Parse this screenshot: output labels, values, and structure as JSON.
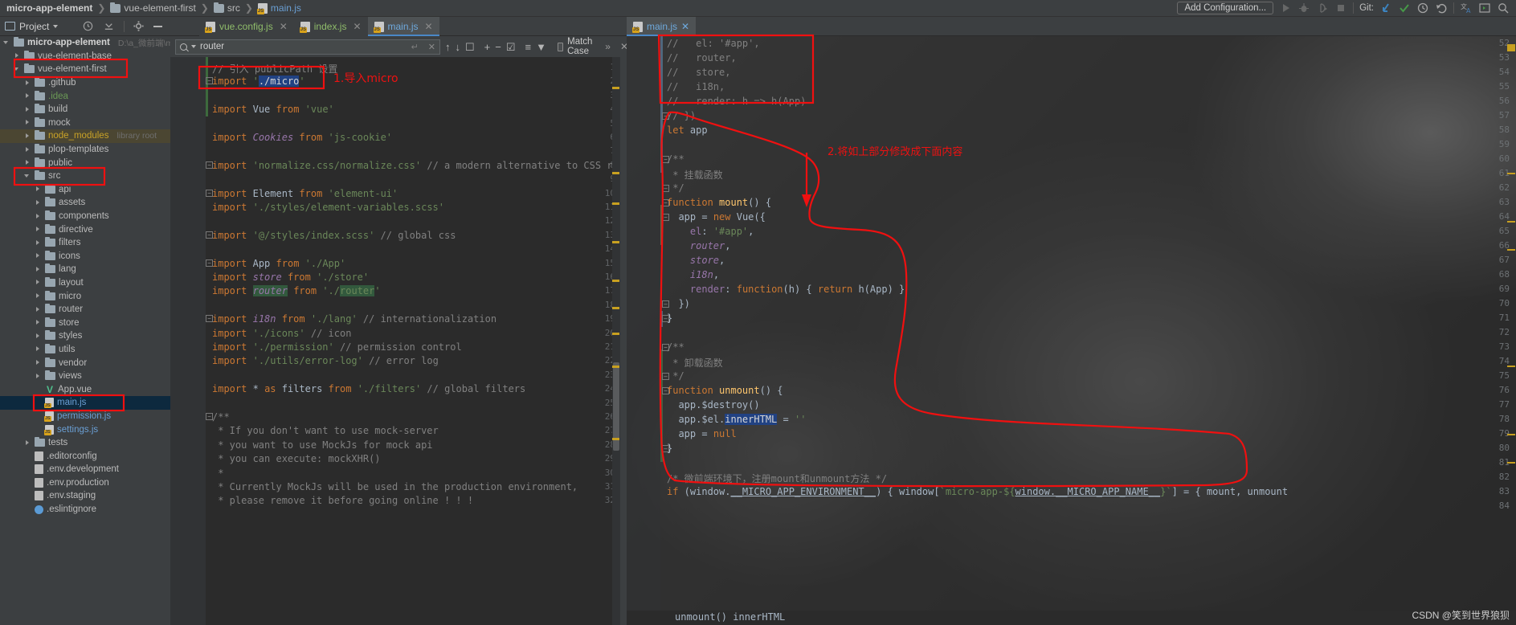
{
  "navbar": {
    "breadcrumbs": [
      {
        "label": "micro-app-element",
        "icon": "none",
        "bold": true
      },
      {
        "label": "vue-element-first",
        "icon": "folder-icon",
        "bold": false
      },
      {
        "label": "src",
        "icon": "folder-icon",
        "bold": false
      },
      {
        "label": "main.js",
        "icon": "js-file-icon",
        "bold": false
      }
    ],
    "add_configuration": "Add Configuration...",
    "git_label": "Git:",
    "icons": [
      "run-icon",
      "debug-icon",
      "coverage-icon",
      "stop-icon",
      "update-project-icon",
      "commit-icon",
      "history-icon",
      "rollback-icon",
      "translate-icon",
      "terminal-icon",
      "search-everywhere-icon"
    ]
  },
  "toolbar": {
    "project_label": "Project",
    "icons": [
      "clock-icon",
      "collapse-icon",
      "gear-icon",
      "minimize-icon"
    ]
  },
  "tabs": [
    {
      "label": "vue.config.js",
      "active": false
    },
    {
      "label": "index.js",
      "active": false
    },
    {
      "label": "main.js",
      "active": true
    }
  ],
  "right_tab": {
    "label": "main.js"
  },
  "find": {
    "query": "router",
    "match_case_label": "Match Case",
    "more_label": "»",
    "icons": [
      "search-icon",
      "prev-match-icon",
      "next-match-icon",
      "select-all-icon",
      "add-occurrence-icon",
      "remove-occurrence-icon",
      "select-all-occurrences-icon",
      "filter-list-icon",
      "filter-icon"
    ]
  },
  "tree": [
    {
      "indent": 0,
      "arrow": "down",
      "icon": "folder-icon",
      "label": "micro-app-element",
      "style": "bold",
      "suffix": "D:\\a_微前端\\micro",
      "highlight": "none"
    },
    {
      "indent": 1,
      "arrow": "right",
      "icon": "folder-icon",
      "label": "vue-element-base",
      "style": "gray",
      "suffix": "",
      "highlight": "none"
    },
    {
      "indent": 1,
      "arrow": "down",
      "icon": "folder-icon",
      "label": "vue-element-first",
      "style": "gray",
      "suffix": "",
      "highlight": "box"
    },
    {
      "indent": 2,
      "arrow": "right",
      "icon": "folder-icon",
      "label": ".github",
      "style": "gray",
      "suffix": "",
      "highlight": "none"
    },
    {
      "indent": 2,
      "arrow": "right",
      "icon": "folder-icon",
      "label": ".idea",
      "style": "green",
      "suffix": "",
      "highlight": "none"
    },
    {
      "indent": 2,
      "arrow": "right",
      "icon": "folder-icon",
      "label": "build",
      "style": "gray",
      "suffix": "",
      "highlight": "none"
    },
    {
      "indent": 2,
      "arrow": "right",
      "icon": "folder-icon",
      "label": "mock",
      "style": "gray",
      "suffix": "",
      "highlight": "none"
    },
    {
      "indent": 2,
      "arrow": "right",
      "icon": "folder-icon",
      "label": "node_modules",
      "style": "yellow",
      "suffix": "library root",
      "highlight": "nm"
    },
    {
      "indent": 2,
      "arrow": "right",
      "icon": "folder-icon",
      "label": "plop-templates",
      "style": "gray",
      "suffix": "",
      "highlight": "none"
    },
    {
      "indent": 2,
      "arrow": "right",
      "icon": "folder-icon",
      "label": "public",
      "style": "gray",
      "suffix": "",
      "highlight": "none"
    },
    {
      "indent": 2,
      "arrow": "down",
      "icon": "folder-icon",
      "label": "src",
      "style": "gray",
      "suffix": "",
      "highlight": "box"
    },
    {
      "indent": 3,
      "arrow": "right",
      "icon": "folder-icon",
      "label": "api",
      "style": "gray",
      "suffix": "",
      "highlight": "none"
    },
    {
      "indent": 3,
      "arrow": "right",
      "icon": "folder-icon",
      "label": "assets",
      "style": "gray",
      "suffix": "",
      "highlight": "none"
    },
    {
      "indent": 3,
      "arrow": "right",
      "icon": "folder-icon",
      "label": "components",
      "style": "gray",
      "suffix": "",
      "highlight": "none"
    },
    {
      "indent": 3,
      "arrow": "right",
      "icon": "folder-icon",
      "label": "directive",
      "style": "gray",
      "suffix": "",
      "highlight": "none"
    },
    {
      "indent": 3,
      "arrow": "right",
      "icon": "folder-icon",
      "label": "filters",
      "style": "gray",
      "suffix": "",
      "highlight": "none"
    },
    {
      "indent": 3,
      "arrow": "right",
      "icon": "folder-icon",
      "label": "icons",
      "style": "gray",
      "suffix": "",
      "highlight": "none"
    },
    {
      "indent": 3,
      "arrow": "right",
      "icon": "folder-icon",
      "label": "lang",
      "style": "gray",
      "suffix": "",
      "highlight": "none"
    },
    {
      "indent": 3,
      "arrow": "right",
      "icon": "folder-icon",
      "label": "layout",
      "style": "gray",
      "suffix": "",
      "highlight": "none"
    },
    {
      "indent": 3,
      "arrow": "right",
      "icon": "folder-icon",
      "label": "micro",
      "style": "gray",
      "suffix": "",
      "highlight": "none"
    },
    {
      "indent": 3,
      "arrow": "right",
      "icon": "folder-icon",
      "label": "router",
      "style": "gray",
      "suffix": "",
      "highlight": "none"
    },
    {
      "indent": 3,
      "arrow": "right",
      "icon": "folder-icon",
      "label": "store",
      "style": "gray",
      "suffix": "",
      "highlight": "none"
    },
    {
      "indent": 3,
      "arrow": "right",
      "icon": "folder-icon",
      "label": "styles",
      "style": "gray",
      "suffix": "",
      "highlight": "none"
    },
    {
      "indent": 3,
      "arrow": "right",
      "icon": "folder-icon",
      "label": "utils",
      "style": "gray",
      "suffix": "",
      "highlight": "none"
    },
    {
      "indent": 3,
      "arrow": "right",
      "icon": "folder-icon",
      "label": "vendor",
      "style": "gray",
      "suffix": "",
      "highlight": "none"
    },
    {
      "indent": 3,
      "arrow": "right",
      "icon": "folder-icon",
      "label": "views",
      "style": "gray",
      "suffix": "",
      "highlight": "none"
    },
    {
      "indent": 3,
      "arrow": "none",
      "icon": "vue-file-icon",
      "label": "App.vue",
      "style": "gray",
      "suffix": "",
      "highlight": "none"
    },
    {
      "indent": 3,
      "arrow": "none",
      "icon": "js-file-icon",
      "label": "main.js",
      "style": "blue",
      "suffix": "",
      "highlight": "selected-box"
    },
    {
      "indent": 3,
      "arrow": "none",
      "icon": "js-file-icon",
      "label": "permission.js",
      "style": "blue",
      "suffix": "",
      "highlight": "none"
    },
    {
      "indent": 3,
      "arrow": "none",
      "icon": "js-file-icon",
      "label": "settings.js",
      "style": "blue",
      "suffix": "",
      "highlight": "none"
    },
    {
      "indent": 2,
      "arrow": "right",
      "icon": "folder-icon",
      "label": "tests",
      "style": "gray",
      "suffix": "",
      "highlight": "none"
    },
    {
      "indent": 2,
      "arrow": "none",
      "icon": "file-icon",
      "label": ".editorconfig",
      "style": "gray",
      "suffix": "",
      "highlight": "none"
    },
    {
      "indent": 2,
      "arrow": "none",
      "icon": "file-icon",
      "label": ".env.development",
      "style": "gray",
      "suffix": "",
      "highlight": "none"
    },
    {
      "indent": 2,
      "arrow": "none",
      "icon": "file-icon",
      "label": ".env.production",
      "style": "gray",
      "suffix": "",
      "highlight": "none"
    },
    {
      "indent": 2,
      "arrow": "none",
      "icon": "file-icon",
      "label": ".env.staging",
      "style": "gray",
      "suffix": "",
      "highlight": "none"
    },
    {
      "indent": 2,
      "arrow": "none",
      "icon": "eslint-icon",
      "label": ".eslintignore",
      "style": "gray",
      "suffix": "",
      "highlight": "none"
    }
  ],
  "editor_left": {
    "first_line": 1,
    "lines": [
      {
        "n": 1,
        "fold": "",
        "html": "<span class=\"c\">// 引入 publicPath 设置</span>"
      },
      {
        "n": 2,
        "fold": "minus",
        "html": "<span class=\"k\">import</span> <span class=\"s\">'</span><span class=\"sel\">./micro</span><span class=\"s\">'</span>"
      },
      {
        "n": 3,
        "fold": "",
        "html": ""
      },
      {
        "n": 4,
        "fold": "",
        "html": "<span class=\"k\">import</span> <span class=\"w\">Vue</span> <span class=\"k\">from</span> <span class=\"s\">'vue'</span>"
      },
      {
        "n": 5,
        "fold": "",
        "html": ""
      },
      {
        "n": 6,
        "fold": "",
        "html": "<span class=\"k\">import</span> <span class=\"v\">Cookies</span> <span class=\"k\">from</span> <span class=\"s\">'js-cookie'</span>"
      },
      {
        "n": 7,
        "fold": "",
        "html": ""
      },
      {
        "n": 8,
        "fold": "minus",
        "html": "<span class=\"k\">import</span> <span class=\"s\">'normalize.css/normalize.css'</span> <span class=\"c\">// a modern alternative to CSS resets</span>"
      },
      {
        "n": 9,
        "fold": "",
        "html": ""
      },
      {
        "n": 10,
        "fold": "minus",
        "html": "<span class=\"k\">import</span> <span class=\"w\">Element</span> <span class=\"k\">from</span> <span class=\"s\">'element-ui'</span>"
      },
      {
        "n": 11,
        "fold": "",
        "html": "<span class=\"k\">import</span> <span class=\"s\">'./styles/element-variables.scss'</span>"
      },
      {
        "n": 12,
        "fold": "",
        "html": ""
      },
      {
        "n": 13,
        "fold": "minus",
        "html": "<span class=\"k\">import</span> <span class=\"s\">'@/styles/index.scss'</span> <span class=\"c\">// global css</span>"
      },
      {
        "n": 14,
        "fold": "",
        "html": ""
      },
      {
        "n": 15,
        "fold": "minus",
        "html": "<span class=\"k\">import</span> <span class=\"w\">App</span> <span class=\"k\">from</span> <span class=\"s\">'./App'</span>"
      },
      {
        "n": 16,
        "fold": "",
        "html": "<span class=\"k\">import</span> <span class=\"v\">store</span> <span class=\"k\">from</span> <span class=\"s\">'./store'</span>"
      },
      {
        "n": 17,
        "fold": "",
        "html": "<span class=\"k\">import</span> <span class=\"v hl\">router</span> <span class=\"k\">from</span> <span class=\"s\">'./</span><span class=\"s hl\">router</span><span class=\"s\">'</span>"
      },
      {
        "n": 18,
        "fold": "",
        "html": ""
      },
      {
        "n": 19,
        "fold": "minus",
        "html": "<span class=\"k\">import</span> <span class=\"v\">i18n</span> <span class=\"k\">from</span> <span class=\"s\">'./lang'</span> <span class=\"c\">// internationalization</span>"
      },
      {
        "n": 20,
        "fold": "",
        "html": "<span class=\"k\">import</span> <span class=\"s\">'./icons'</span> <span class=\"c\">// icon</span>"
      },
      {
        "n": 21,
        "fold": "",
        "html": "<span class=\"k\">import</span> <span class=\"s\">'./permission'</span> <span class=\"c\">// permission control</span>"
      },
      {
        "n": 22,
        "fold": "",
        "html": "<span class=\"k\">import</span> <span class=\"s\">'./utils/error-log'</span> <span class=\"c\">// error log</span>"
      },
      {
        "n": 23,
        "fold": "",
        "html": ""
      },
      {
        "n": 24,
        "fold": "",
        "html": "<span class=\"k\">import</span> <span class=\"w\">*</span> <span class=\"k\">as</span> <span class=\"w\">filters</span> <span class=\"k\">from</span> <span class=\"s\">'./filters'</span> <span class=\"c\">// global filters</span>"
      },
      {
        "n": 25,
        "fold": "",
        "html": ""
      },
      {
        "n": 26,
        "fold": "minus",
        "html": "<span class=\"c\">/**</span>"
      },
      {
        "n": 27,
        "fold": "",
        "html": "<span class=\"c\"> * If you don't want to use mock-server</span>"
      },
      {
        "n": 28,
        "fold": "",
        "html": "<span class=\"c\"> * you want to use MockJs for mock api</span>"
      },
      {
        "n": 29,
        "fold": "",
        "html": "<span class=\"c\"> * you can execute: mockXHR()</span>"
      },
      {
        "n": 30,
        "fold": "",
        "html": "<span class=\"c\"> *</span>"
      },
      {
        "n": 31,
        "fold": "",
        "html": "<span class=\"c\"> * Currently MockJs will be used in the production environment,</span>"
      },
      {
        "n": 32,
        "fold": "",
        "html": "<span class=\"c\"> * please remove it before going online ! ! !</span>"
      }
    ]
  },
  "editor_right": {
    "lines": [
      {
        "n": 52,
        "fold": "",
        "html": "<span class=\"c\">//   el: '#app',</span>"
      },
      {
        "n": 53,
        "fold": "",
        "html": "<span class=\"c\">//   router,</span>"
      },
      {
        "n": 54,
        "fold": "",
        "html": "<span class=\"c\">//   store,</span>"
      },
      {
        "n": 55,
        "fold": "",
        "html": "<span class=\"c\">//   i18n,</span>"
      },
      {
        "n": 56,
        "fold": "",
        "html": "<span class=\"c\">//   render: h =&gt; h(App)</span>"
      },
      {
        "n": 57,
        "fold": "minus",
        "html": "<span class=\"c\">// })</span>"
      },
      {
        "n": 58,
        "fold": "",
        "html": "<span class=\"k\">let</span> <span class=\"w\">app</span>"
      },
      {
        "n": 59,
        "fold": "",
        "html": ""
      },
      {
        "n": 60,
        "fold": "minus",
        "html": "<span class=\"c\">/**</span>"
      },
      {
        "n": 61,
        "fold": "",
        "html": "<span class=\"cj\"> * 挂载函数</span>"
      },
      {
        "n": 62,
        "fold": "end",
        "html": "<span class=\"c\"> */</span>"
      },
      {
        "n": 63,
        "fold": "minus",
        "html": "<span class=\"k\">function</span> <span class=\"w\" style=\"color:#ffc66d\">mount</span><span class=\"w\">() {</span>"
      },
      {
        "n": 64,
        "fold": "minus",
        "html": "  <span class=\"w\">app = </span><span class=\"k\">new</span><span class=\"w\"> Vue({</span>"
      },
      {
        "n": 65,
        "fold": "",
        "html": "    <span class=\"v\" style=\"font-style:normal\">el</span><span class=\"w\">: </span><span class=\"s\">'#app'</span><span class=\"w\">,</span>"
      },
      {
        "n": 66,
        "fold": "",
        "html": "    <span class=\"v\">router</span><span class=\"w\">,</span>"
      },
      {
        "n": 67,
        "fold": "",
        "html": "    <span class=\"v\">store</span><span class=\"w\">,</span>"
      },
      {
        "n": 68,
        "fold": "",
        "html": "    <span class=\"v\">i18n</span><span class=\"w\">,</span>"
      },
      {
        "n": 69,
        "fold": "",
        "html": "    <span class=\"v\" style=\"font-style:normal\">render</span><span class=\"w\">: </span><span class=\"k\">function</span><span class=\"w\">(h) { </span><span class=\"k\">return</span><span class=\"w\"> h(App) }</span>"
      },
      {
        "n": 70,
        "fold": "end",
        "html": "  <span class=\"w\">})</span>"
      },
      {
        "n": 71,
        "fold": "end",
        "html": "<span class=\"w\">}</span>"
      },
      {
        "n": 72,
        "fold": "",
        "html": ""
      },
      {
        "n": 73,
        "fold": "minus",
        "html": "<span class=\"c\">/**</span>"
      },
      {
        "n": 74,
        "fold": "",
        "html": "<span class=\"cj\"> * 卸载函数</span>"
      },
      {
        "n": 75,
        "fold": "end",
        "html": "<span class=\"c\"> */</span>"
      },
      {
        "n": 76,
        "fold": "minus",
        "html": "<span class=\"k\">function</span> <span class=\"w\" style=\"color:#ffc66d\">unmount</span><span class=\"w\">() {</span>"
      },
      {
        "n": 77,
        "fold": "",
        "html": "  <span class=\"w\">app.$destroy()</span>"
      },
      {
        "n": 78,
        "fold": "",
        "html": "  <span class=\"w\">app.$el.</span><span class=\"sel\">innerHTML</span><span class=\"w\"> = </span><span class=\"s\">''</span>"
      },
      {
        "n": 79,
        "fold": "",
        "html": "  <span class=\"w\">app = </span><span class=\"k\">null</span>"
      },
      {
        "n": 80,
        "fold": "end",
        "html": "<span class=\"w\">}</span>"
      },
      {
        "n": 81,
        "fold": "",
        "html": ""
      },
      {
        "n": 82,
        "fold": "",
        "html": "<span class=\"cj\">/* 微前端环境下，注册mount和unmount方法 */</span>"
      },
      {
        "n": 83,
        "fold": "",
        "html": "<span class=\"k\">if</span><span class=\"w\"> (window.</span><span class=\"w\" style=\"text-decoration:underline\">__MICRO_APP_ENVIRONMENT__</span><span class=\"w\">) { window[</span><span class=\"s\">`micro-app-${</span><span class=\"w\" style=\"text-decoration:underline\">window.__MICRO_APP_NAME__</span><span class=\"s\">}`</span><span class=\"w\">] = { mount, unmount</span>"
      },
      {
        "n": 84,
        "fold": "",
        "html": ""
      }
    ],
    "bottom_text": "unmount()   innerHTML"
  },
  "annotations": [
    {
      "id": "anno-1",
      "text": "1.导入micro",
      "color": "#ee1111"
    },
    {
      "id": "anno-2",
      "text": "2.将如上部分修改成下面内容",
      "color": "#ee1111"
    }
  ],
  "watermark": "CSDN @笑到世界狼狈",
  "colors": {
    "accent_blue": "#4a88c7",
    "annotation_red": "#ee1111",
    "editor_bg": "#2b2b2b",
    "panel_bg": "#3c3f41",
    "selection_blue": "#214283",
    "match_highlight": "#32593d",
    "selected_row": "#0d293e"
  }
}
